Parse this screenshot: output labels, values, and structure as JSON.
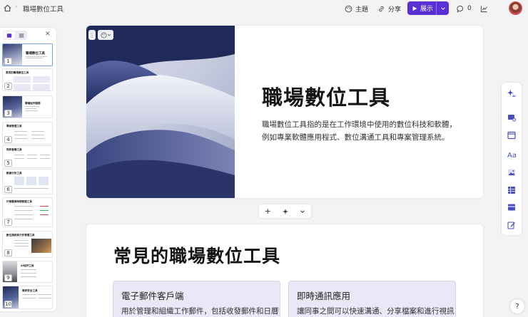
{
  "breadcrumb": {
    "separator": "›",
    "title": "職場數位工具"
  },
  "toolbar": {
    "theme_label": "主題",
    "share_label": "分享",
    "present_label": "展示",
    "comment_count": "0"
  },
  "thumbnails": [
    {
      "num": "1",
      "title": "職場數位工具"
    },
    {
      "num": "2",
      "title": "常見的職場數位工具"
    },
    {
      "num": "3",
      "title": "雲端協作服務"
    },
    {
      "num": "4",
      "title": "專案管理工具"
    },
    {
      "num": "5",
      "title": "視訊會議工具"
    },
    {
      "num": "6",
      "title": "數據分析工具"
    },
    {
      "num": "7",
      "title": "行事曆與時間管理工具"
    },
    {
      "num": "8",
      "title": "數位通訊與文件管理工具"
    },
    {
      "num": "9",
      "title": "AI協作工具"
    },
    {
      "num": "10",
      "title": "資訊安全工具"
    }
  ],
  "slide1": {
    "title": "職場數位工具",
    "description": "職場數位工具指的是在工作環境中使用的數位科技和軟體，例如專業軟體應用程式、數位溝通工具和專案管理系統。"
  },
  "slide2": {
    "title": "常見的職場數位工具",
    "cards": [
      {
        "title": "電子郵件客戶端",
        "body": "用於管理和組織工作郵件，包括收發郵件和日曆"
      },
      {
        "title": "即時通訊應用",
        "body": "讓同事之間可以快速溝通、分享檔案和進行視訊"
      }
    ]
  },
  "help_label": "?",
  "colors": {
    "accent": "#5b2fd6",
    "card_bg": "#e9e8f7"
  }
}
